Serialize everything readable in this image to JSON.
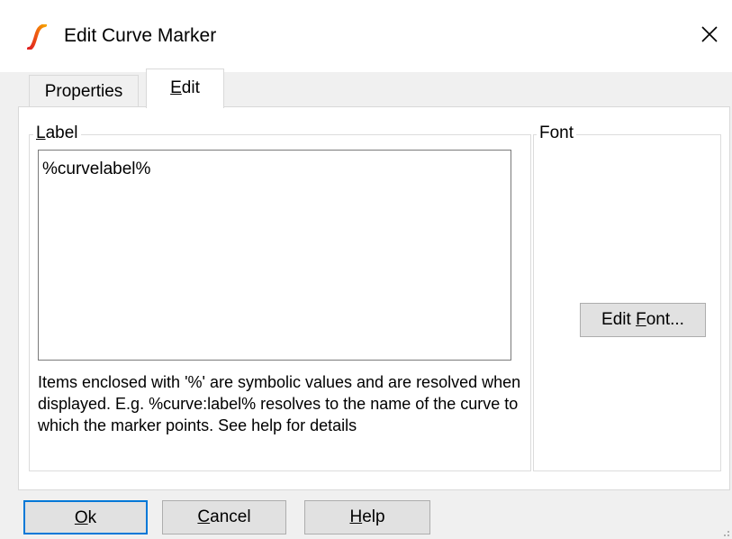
{
  "window": {
    "title": "Edit Curve Marker",
    "icon": "curve-logo-icon",
    "close_icon": "close-icon"
  },
  "tabs": [
    {
      "label": "Properties",
      "mnemonic_prefix": "",
      "mnemonic": "",
      "rest": "Properties"
    },
    {
      "label": "Edit",
      "mnemonic_prefix": "",
      "mnemonic": "E",
      "rest": "dit"
    }
  ],
  "label_group": {
    "title_mnemonic": "L",
    "title_rest": "abel",
    "text_value": "%curvelabel%",
    "hint": "Items enclosed with '%' are symbolic values and are resolved when displayed. E.g. %curve:label% resolves to the name of the curve to which the marker points. See help for details"
  },
  "font_group": {
    "title": "Font",
    "edit_font_prefix": "Edit ",
    "edit_font_mnemonic": "F",
    "edit_font_rest": "ont..."
  },
  "buttons": {
    "ok_mnemonic": "O",
    "ok_rest": "k",
    "cancel_mnemonic": "C",
    "cancel_rest": "ancel",
    "help_mnemonic": "H",
    "help_rest": "elp"
  },
  "colors": {
    "accent": "#0078d7",
    "logo_red": "#e02020",
    "logo_orange": "#f5a000"
  }
}
